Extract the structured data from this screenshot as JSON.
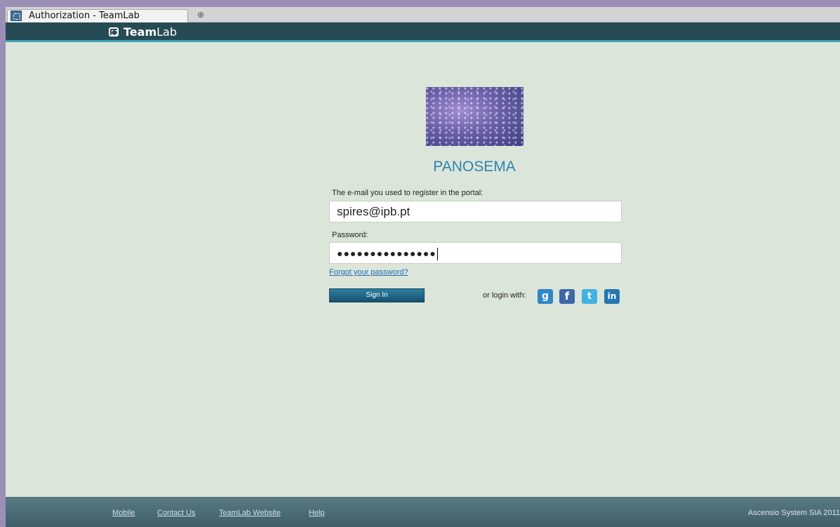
{
  "browser": {
    "tab_title": "Authorization - TeamLab",
    "new_tab_glyph": "⊕"
  },
  "header": {
    "logo_team": "Team",
    "logo_lab": "Lab"
  },
  "login": {
    "portal_name": "PANOSEMA",
    "email_label": "The e-mail you used to register in the portal:",
    "email_value": "spires@ipb.pt",
    "password_label": "Password:",
    "password_value": "●●●●●●●●●●●●●●●",
    "forgot_link": "Forgot your password?",
    "sign_in_label": "Sign In",
    "or_login_with": "or login with:",
    "social": {
      "google": "g",
      "facebook": "f",
      "twitter": "t",
      "linkedin": "in"
    }
  },
  "footer": {
    "links": [
      "Mobile",
      "Contact Us",
      "TeamLab Website",
      "Help"
    ],
    "copyright": "Ascensio System SIA 2011"
  }
}
